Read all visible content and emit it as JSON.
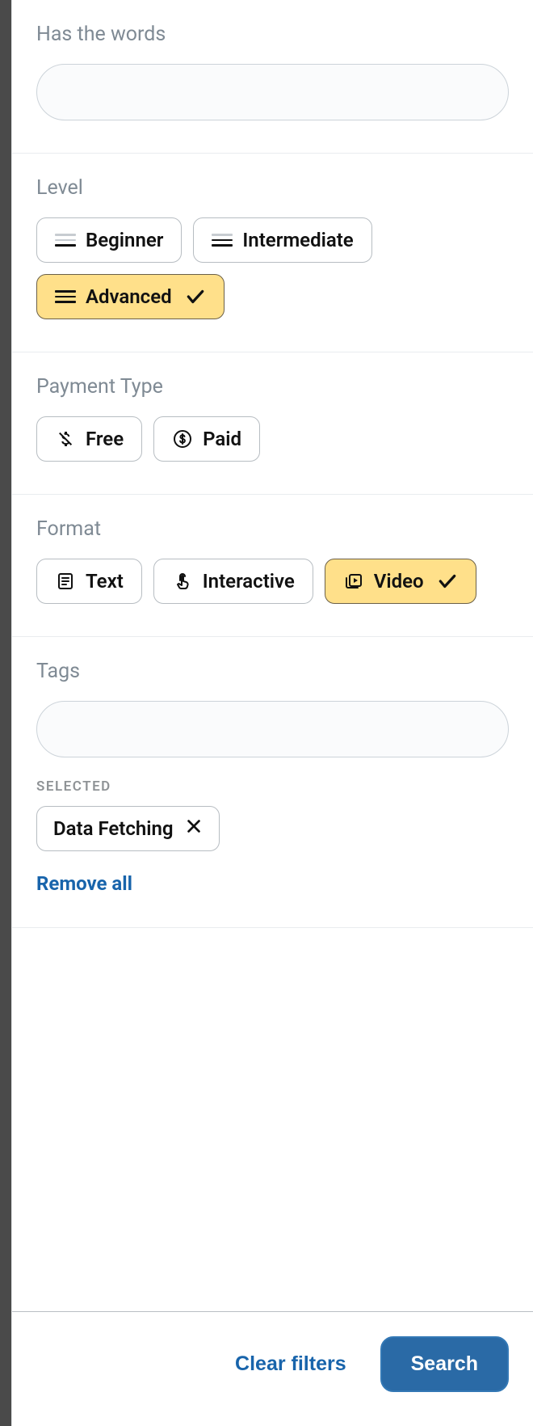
{
  "filters": {
    "hasWords": {
      "label": "Has the words",
      "value": ""
    },
    "level": {
      "label": "Level",
      "beginner": "Beginner",
      "intermediate": "Intermediate",
      "advanced": "Advanced"
    },
    "payment": {
      "label": "Payment Type",
      "free": "Free",
      "paid": "Paid"
    },
    "format": {
      "label": "Format",
      "text": "Text",
      "interactive": "Interactive",
      "video": "Video"
    },
    "tags": {
      "label": "Tags",
      "value": "",
      "selectedLabel": "SELECTED",
      "items": {
        "0": {
          "label": "Data Fetching"
        }
      },
      "removeAll": "Remove all"
    }
  },
  "footer": {
    "clear": "Clear filters",
    "search": "Search"
  }
}
